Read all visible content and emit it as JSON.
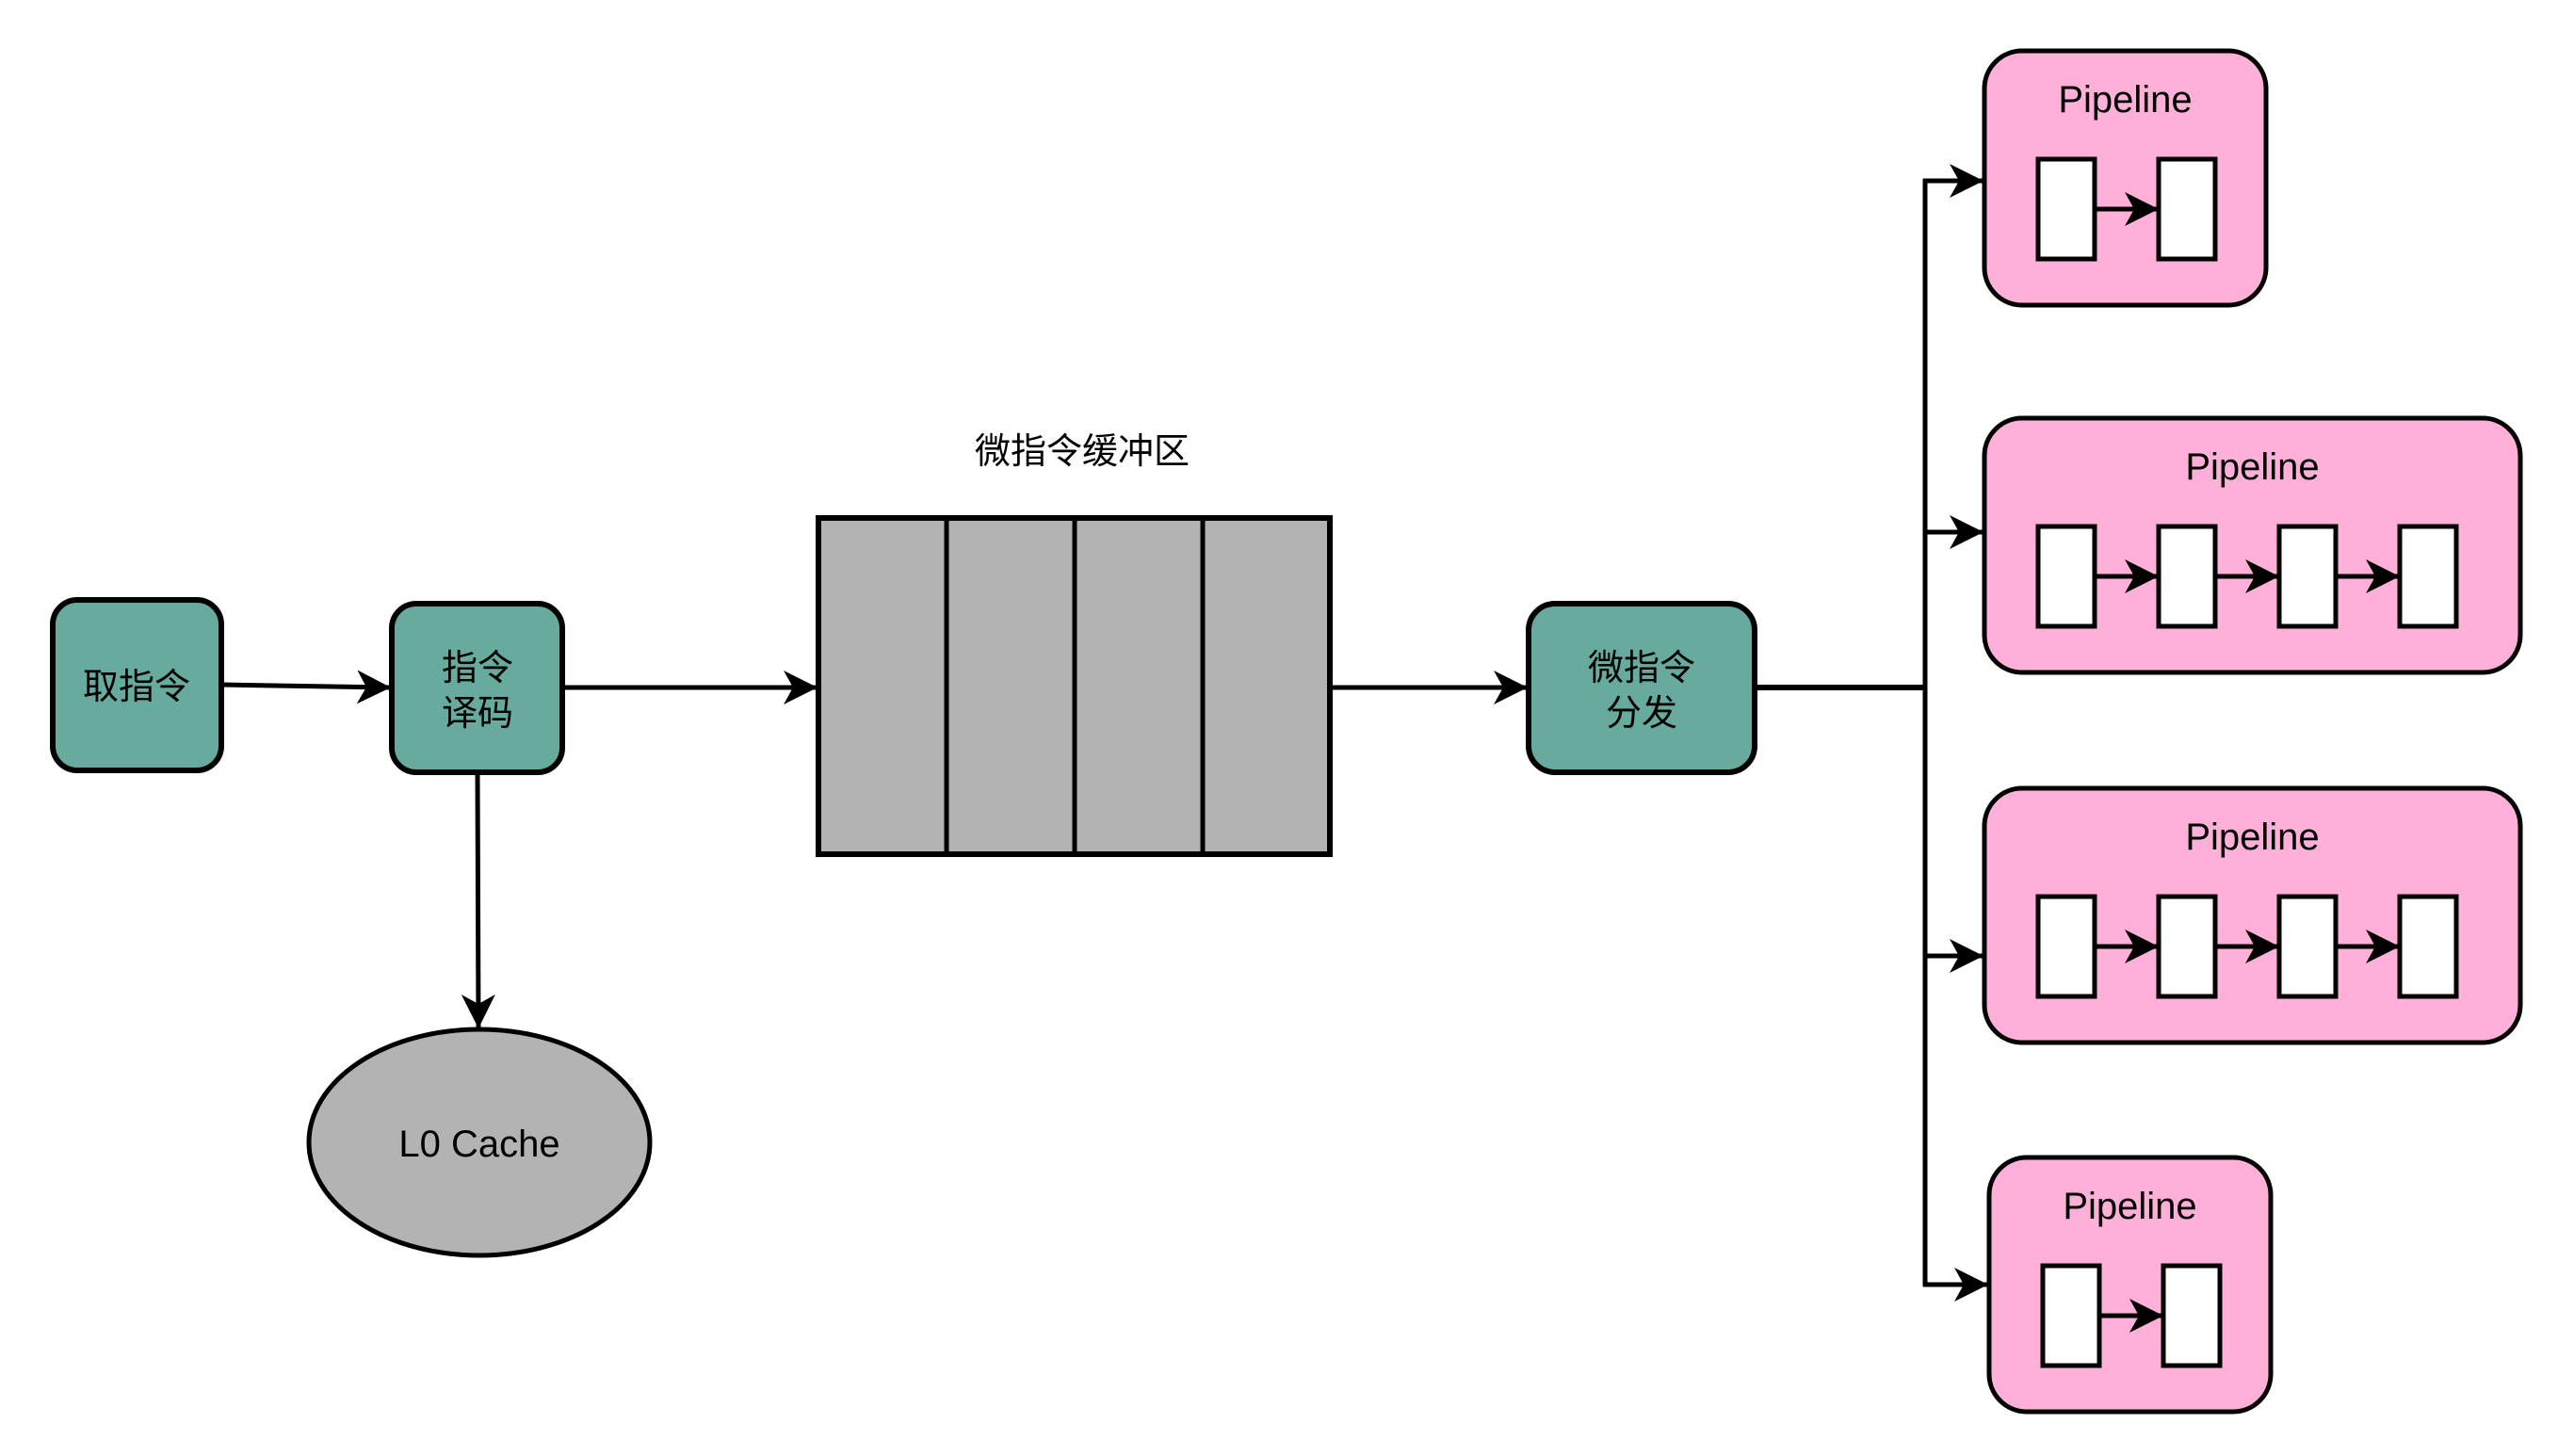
{
  "diagram": {
    "colors": {
      "stage_fill": "#67AB9F",
      "cache_fill": "#B3B3B3",
      "buffer_fill": "#B3B3B3",
      "pipeline_fill": "#FFB0D8",
      "pipeline_stage_fill": "#FFFFFF",
      "stroke": "#000000"
    },
    "nodes": {
      "fetch": {
        "lines": [
          "取指令"
        ]
      },
      "decode": {
        "lines": [
          "指令",
          "译码"
        ]
      },
      "l0_cache": {
        "label": "L0 Cache"
      },
      "uop_buffer": {
        "title": "微指令缓冲区",
        "slots": 4
      },
      "dispatch": {
        "lines": [
          "微指令",
          "分发"
        ]
      }
    },
    "pipelines": [
      {
        "label": "Pipeline",
        "stages": 2
      },
      {
        "label": "Pipeline",
        "stages": 4
      },
      {
        "label": "Pipeline",
        "stages": 4
      },
      {
        "label": "Pipeline",
        "stages": 2
      }
    ],
    "edges": [
      {
        "from": "fetch",
        "to": "decode"
      },
      {
        "from": "decode",
        "to": "uop_buffer"
      },
      {
        "from": "decode",
        "to": "l0_cache"
      },
      {
        "from": "uop_buffer",
        "to": "dispatch"
      },
      {
        "from": "dispatch",
        "to": "pipeline-1"
      },
      {
        "from": "dispatch",
        "to": "pipeline-2"
      },
      {
        "from": "dispatch",
        "to": "pipeline-3"
      },
      {
        "from": "dispatch",
        "to": "pipeline-4"
      }
    ]
  }
}
